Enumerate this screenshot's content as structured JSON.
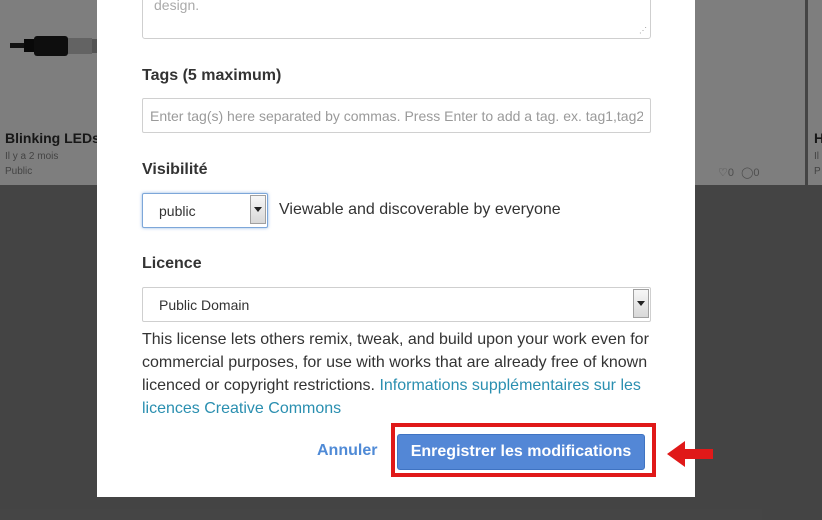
{
  "background": {
    "left_card": {
      "title": "Blinking LEDs",
      "time": "Il y a 2 mois",
      "status": "Public"
    },
    "middle_card": {
      "likes": "0",
      "comments": "0"
    },
    "right_card": {
      "title": "H",
      "sub1": "Il",
      "sub2": "P"
    }
  },
  "modal": {
    "description_value": "design.",
    "tags": {
      "label": "Tags (5 maximum)",
      "placeholder": "Enter tag(s) here separated by commas. Press Enter to add a tag. ex. tag1,tag2"
    },
    "visibility": {
      "label": "Visibilité",
      "selected": "public",
      "description": "Viewable and discoverable by everyone"
    },
    "licence": {
      "label": "Licence",
      "selected": "Public Domain",
      "description": "This license lets others remix, tweak, and build upon your work even for commercial purposes, for use with works that are already free of known licenced or copyright restrictions.",
      "link_text": "Informations supplémentaires sur les licences Creative Commons"
    },
    "actions": {
      "cancel_label": "Annuler",
      "save_label": "Enregistrer les modifications"
    }
  },
  "colors": {
    "primary_button": "#5387d6",
    "link": "#2a8fb0",
    "highlight": "#e01919"
  },
  "icons": [
    "usb-cable-icon",
    "heart-icon",
    "comment-icon",
    "resize-grip-icon",
    "chevron-down-icon",
    "arrow-left-icon"
  ]
}
